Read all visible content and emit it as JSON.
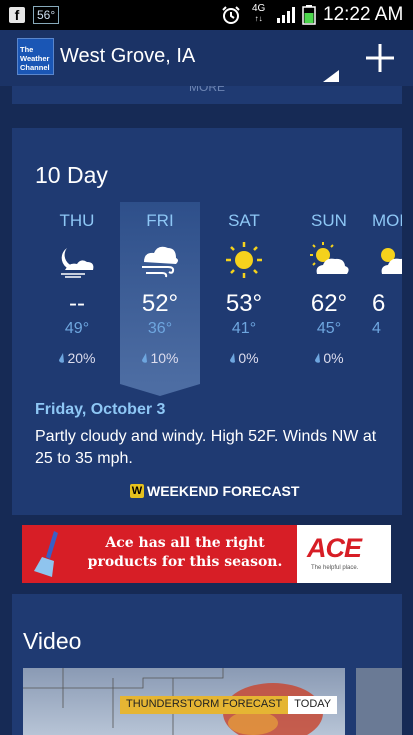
{
  "status_bar": {
    "fb_glyph": "f",
    "temp_badge": "56°",
    "network": "4G",
    "time": "12:22 AM"
  },
  "header": {
    "logo_text": "The Weather Channel",
    "location": "West Grove, IA",
    "more_label": "MORE"
  },
  "forecast": {
    "title": "10 Day",
    "days": [
      {
        "name": "THU",
        "high": "--",
        "low": "49°",
        "precip": "20%",
        "icon": "night-cloudy-windy-icon"
      },
      {
        "name": "FRI",
        "high": "52°",
        "low": "36°",
        "precip": "10%",
        "icon": "cloudy-windy-icon"
      },
      {
        "name": "SAT",
        "high": "53°",
        "low": "41°",
        "precip": "0%",
        "icon": "sunny-icon"
      },
      {
        "name": "SUN",
        "high": "62°",
        "low": "45°",
        "precip": "0%",
        "icon": "partly-cloudy-icon"
      },
      {
        "name": "MON",
        "high": "6",
        "low": "4",
        "precip": "",
        "icon": "partly-cloudy-icon"
      }
    ],
    "detail_date": "Friday, October 3",
    "detail_text": "Partly cloudy and windy. High 52F. Winds NW at 25 to 35 mph.",
    "weekend_link": "WEEKEND FORECAST",
    "weekend_icon_letter": "W"
  },
  "ad": {
    "text": "Ace has all the right products for this season.",
    "logo": "ACE",
    "tagline": "The helpful place."
  },
  "video": {
    "title": "Video",
    "thumb_label": "THUNDERSTORM FORECAST",
    "thumb_tag": "TODAY"
  },
  "colors": {
    "background": "#162a55",
    "card": "#1f3a72",
    "accent": "#8ec7f5",
    "ad_red": "#d71e26"
  }
}
